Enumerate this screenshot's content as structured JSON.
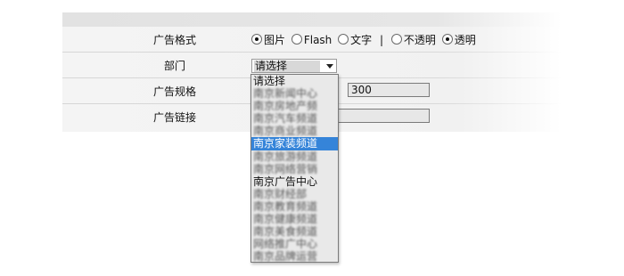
{
  "form": {
    "format": {
      "label": "广告格式",
      "options": [
        {
          "text": "图片",
          "checked": true
        },
        {
          "text": "Flash",
          "checked": false
        },
        {
          "text": "文字",
          "checked": false
        }
      ],
      "separator": "|",
      "opacity_options": [
        {
          "text": "不透明",
          "checked": false
        },
        {
          "text": "透明",
          "checked": true
        }
      ]
    },
    "department": {
      "label": "部门",
      "selected": "请选择"
    },
    "size": {
      "label": "广告规格",
      "times": "×",
      "height": "300"
    },
    "link": {
      "label": "广告链接",
      "value": ""
    }
  },
  "dropdown": {
    "options": [
      {
        "text": "请选择",
        "blurred": false,
        "highlighted": false
      },
      {
        "text": "南京新闻中心",
        "blurred": true,
        "highlighted": false
      },
      {
        "text": "南京房地产频",
        "blurred": true,
        "highlighted": false
      },
      {
        "text": "南京汽车频道",
        "blurred": true,
        "highlighted": false
      },
      {
        "text": "南京商业频道",
        "blurred": true,
        "highlighted": false
      },
      {
        "text": "南京家装频道",
        "blurred": false,
        "highlighted": true
      },
      {
        "text": "南京旅游频道",
        "blurred": true,
        "highlighted": false
      },
      {
        "text": "南京网络营销",
        "blurred": true,
        "highlighted": false
      },
      {
        "text": "南京广告中心",
        "blurred": false,
        "highlighted": false
      },
      {
        "text": "南京财经部",
        "blurred": true,
        "highlighted": false
      },
      {
        "text": "南京教育频道",
        "blurred": true,
        "highlighted": false
      },
      {
        "text": "南京健康频道",
        "blurred": true,
        "highlighted": false
      },
      {
        "text": "南京美食频道",
        "blurred": true,
        "highlighted": false
      },
      {
        "text": "网络推广中心",
        "blurred": true,
        "highlighted": false
      },
      {
        "text": "南京品牌运营",
        "blurred": true,
        "highlighted": false
      }
    ]
  }
}
